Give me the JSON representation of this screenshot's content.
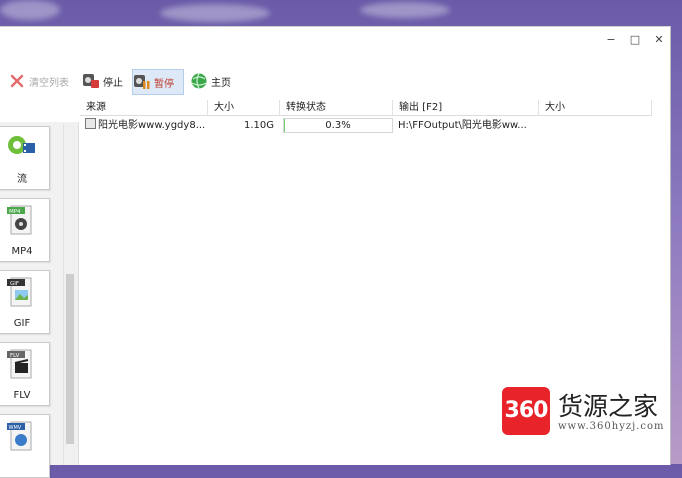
{
  "window": {
    "controls": {
      "minimize": "−",
      "maximize": "□",
      "close": "✕"
    }
  },
  "toolbar": {
    "clear_list": "清空列表",
    "stop": "停止",
    "pause": "暂停",
    "home": "主页"
  },
  "formats": [
    {
      "label": "流",
      "icon": "video-convert-icon"
    },
    {
      "label": "MP4",
      "icon": "mp4-file-icon",
      "tag": "MP4"
    },
    {
      "label": "GIF",
      "icon": "gif-file-icon",
      "tag": "GIF"
    },
    {
      "label": "FLV",
      "icon": "flv-file-icon",
      "tag": "FLV"
    },
    {
      "label": "",
      "icon": "wmv-file-icon",
      "tag": "WMV"
    }
  ],
  "table": {
    "columns": [
      "来源",
      "大小",
      "转换状态",
      "输出 [F2]",
      "大小"
    ],
    "rows": [
      {
        "source": "阳光电影www.ygdy8...",
        "size": "1.10G",
        "status": "0.3%",
        "progress": 0.003,
        "output": "H:\\FFOutput\\阳光电影ww...",
        "out_size": ""
      }
    ]
  },
  "watermark": {
    "badge": "360",
    "title": "货源之家",
    "url": "www.360hyzj.com"
  },
  "colors": {
    "accent": "#e8232a",
    "progress": "#6fcf6f",
    "active_button": "#dde9f7"
  }
}
